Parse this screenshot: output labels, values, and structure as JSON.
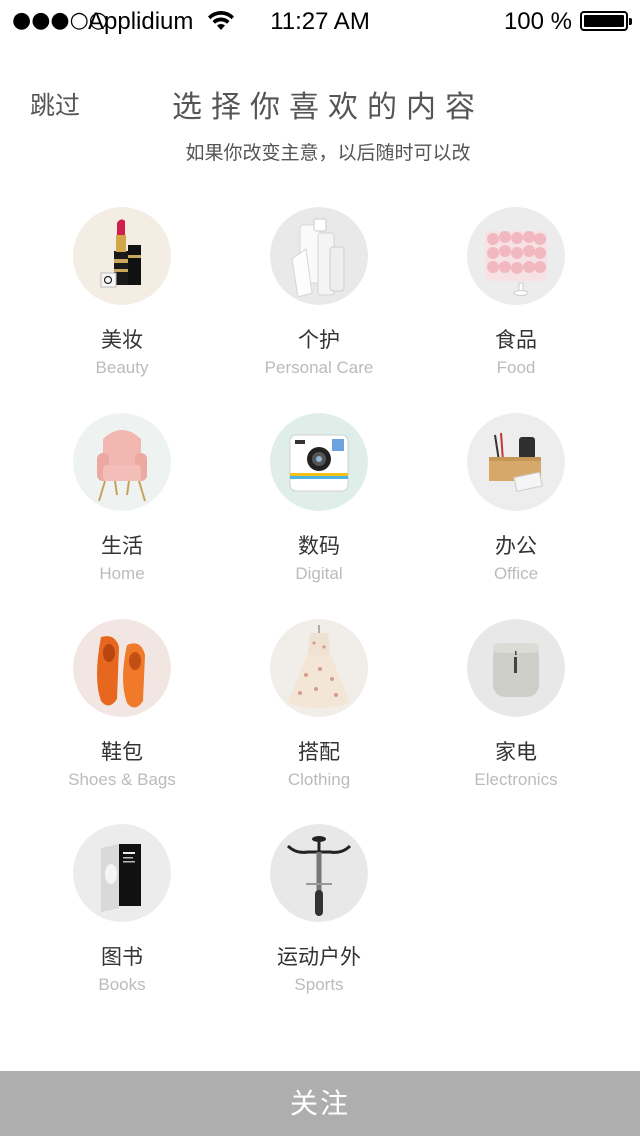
{
  "status_bar": {
    "signal": "●●●○○",
    "carrier": "Applidium",
    "time": "11:27 AM",
    "battery": "100 %"
  },
  "header": {
    "skip_label": "跳过",
    "title": "选择你喜欢的内容",
    "subtitle": "如果你改变主意，以后随时可以改"
  },
  "categories": [
    {
      "cn": "美妆",
      "en": "Beauty",
      "icon": "lipstick-icon"
    },
    {
      "cn": "个护",
      "en": "Personal Care",
      "icon": "skincare-bottles-icon"
    },
    {
      "cn": "食品",
      "en": "Food",
      "icon": "cake-icon"
    },
    {
      "cn": "生活",
      "en": "Home",
      "icon": "armchair-icon"
    },
    {
      "cn": "数码",
      "en": "Digital",
      "icon": "camera-icon"
    },
    {
      "cn": "办公",
      "en": "Office",
      "icon": "desk-organizer-icon"
    },
    {
      "cn": "鞋包",
      "en": "Shoes & Bags",
      "icon": "loafers-icon"
    },
    {
      "cn": "搭配",
      "en": "Clothing",
      "icon": "dress-icon"
    },
    {
      "cn": "家电",
      "en": "Electronics",
      "icon": "humidifier-icon"
    },
    {
      "cn": "图书",
      "en": "Books",
      "icon": "book-icon"
    },
    {
      "cn": "运动户外",
      "en": "Sports",
      "icon": "bicycle-icon"
    }
  ],
  "footer": {
    "follow_label": "关注"
  },
  "colors": {
    "follow_bar_bg": "#aeaeae",
    "english_label": "#bbbbbb"
  }
}
